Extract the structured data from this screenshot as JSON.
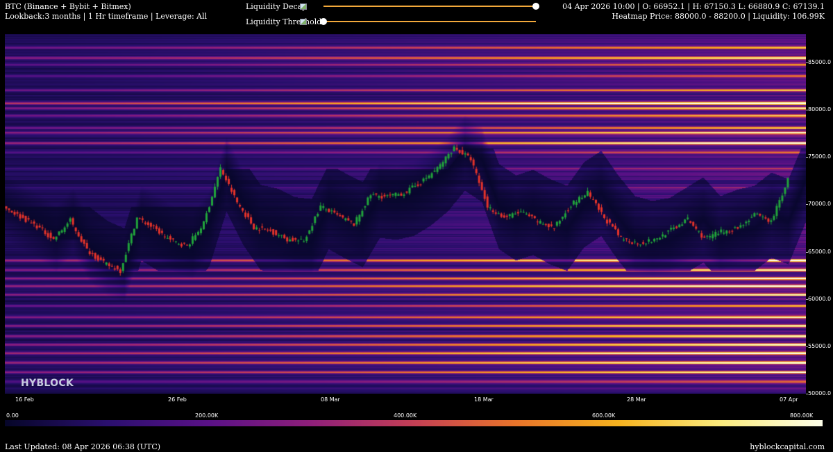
{
  "header": {
    "title": "BTC (Binance + Bybit + Bitmex)",
    "subtitle": "Lookback:3 months | 1 Hr timeframe | Leverage: All",
    "ohlc": "04 Apr 2026 10:00 | O: 66952.1 | H: 67150.3 L: 66880.9 C: 67139.1",
    "heatmap_info": "Heatmap Price: 88000.0 - 88200.0 | Liquidity: 106.99K"
  },
  "controls": {
    "decay_label": "Liquidity Decay",
    "decay_value": 1.0,
    "threshold_label": "Liquidity Threshold",
    "threshold_value": 0.0,
    "slider_color": "#f2a93b"
  },
  "brand": "HYBLOCK",
  "footer": {
    "updated": "Last Updated: 08 Apr 2026 06:38 (UTC)",
    "site": "hyblockcapital.com"
  },
  "chart_data": {
    "type": "heatmap",
    "title": "",
    "xlabel": "",
    "ylabel": "",
    "ylim": [
      50000,
      88000
    ],
    "x_ticks": [
      "16 Feb",
      "26 Feb",
      "08 Mar",
      "18 Mar",
      "28 Mar",
      "07 Apr"
    ],
    "y_ticks": [
      "85000.0",
      "80000.0",
      "75000.0",
      "70000.0",
      "65000.0",
      "60000.0",
      "55000.0",
      "50000.0"
    ],
    "y_tick_values": [
      85000,
      80000,
      75000,
      70000,
      65000,
      60000,
      55000,
      50000
    ],
    "colorbar": {
      "ticks": [
        "0.00",
        "200.00K",
        "400.00K",
        "600.00K",
        "800.00K"
      ],
      "tick_values": [
        0,
        200000,
        400000,
        600000,
        800000
      ],
      "max": 830000,
      "colors": [
        "#060629",
        "#2a0f6e",
        "#5a1187",
        "#8f1f7a",
        "#c43f55",
        "#e8742a",
        "#f6b21f",
        "#fbeb7d",
        "#fcfde8"
      ]
    },
    "price_series": {
      "name": "BTC",
      "x": [
        "15 Feb",
        "16 Feb",
        "18 Feb",
        "20 Feb",
        "22 Feb",
        "23 Feb",
        "24 Feb",
        "25 Feb",
        "26 Feb",
        "27 Feb",
        "28 Feb",
        "01 Mar",
        "02 Mar",
        "03 Mar",
        "04 Mar",
        "05 Mar",
        "06 Mar",
        "07 Mar",
        "08 Mar",
        "09 Mar",
        "10 Mar",
        "11 Mar",
        "12 Mar",
        "13 Mar",
        "14 Mar",
        "15 Mar",
        "16 Mar",
        "17 Mar",
        "18 Mar",
        "19 Mar",
        "20 Mar",
        "21 Mar",
        "22 Mar",
        "23 Mar",
        "24 Mar",
        "25 Mar",
        "26 Mar",
        "27 Mar",
        "28 Mar",
        "30 Mar",
        "01 Apr",
        "02 Apr",
        "03 Apr",
        "04 Apr",
        "05 Apr",
        "06 Apr",
        "07 Apr",
        "08 Apr"
      ],
      "y": [
        69800,
        68700,
        67700,
        66300,
        68300,
        65200,
        63800,
        63000,
        68600,
        67500,
        66200,
        65600,
        68000,
        73800,
        70200,
        67600,
        67200,
        66300,
        66100,
        69800,
        68800,
        67900,
        71000,
        70800,
        71200,
        72300,
        73800,
        76000,
        74800,
        69800,
        68600,
        69200,
        68200,
        67500,
        70000,
        71200,
        68600,
        66400,
        65900,
        66200,
        67300,
        68400,
        66400,
        67100,
        67500,
        68900,
        68200,
        72600
      ],
      "up_color": "#21a33b",
      "down_color": "#e5332a"
    },
    "liquidity_bands": [
      {
        "price": 86600,
        "value": 420000
      },
      {
        "price": 85500,
        "value": 610000
      },
      {
        "price": 84800,
        "value": 380000
      },
      {
        "price": 83600,
        "value": 330000
      },
      {
        "price": 82100,
        "value": 400000
      },
      {
        "price": 80700,
        "value": 760000
      },
      {
        "price": 80200,
        "value": 560000
      },
      {
        "price": 79400,
        "value": 470000
      },
      {
        "price": 78100,
        "value": 430000
      },
      {
        "price": 77600,
        "value": 560000
      },
      {
        "price": 76500,
        "value": 630000
      },
      {
        "price": 75500,
        "value": 270000
      },
      {
        "price": 73800,
        "value": 190000
      },
      {
        "price": 71800,
        "value": 160000
      },
      {
        "price": 64100,
        "value": 700000
      },
      {
        "price": 63100,
        "value": 520000
      },
      {
        "price": 62200,
        "value": 580000
      },
      {
        "price": 61400,
        "value": 610000
      },
      {
        "price": 60500,
        "value": 550000
      },
      {
        "price": 59300,
        "value": 470000
      },
      {
        "price": 58100,
        "value": 510000
      },
      {
        "price": 57200,
        "value": 620000
      },
      {
        "price": 56100,
        "value": 570000
      },
      {
        "price": 55200,
        "value": 600000
      },
      {
        "price": 54300,
        "value": 650000
      },
      {
        "price": 53300,
        "value": 720000
      },
      {
        "price": 52300,
        "value": 540000
      },
      {
        "price": 51300,
        "value": 300000
      }
    ]
  }
}
